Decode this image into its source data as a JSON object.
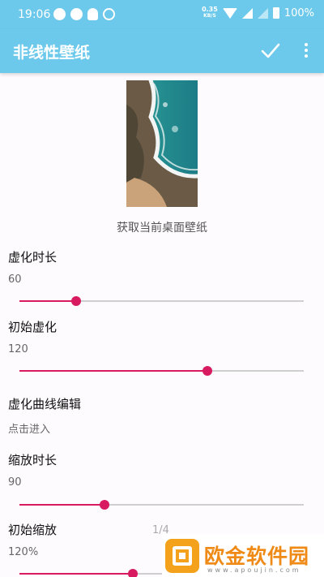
{
  "statusbar": {
    "time": "19:06",
    "net_speed": "0.35",
    "net_unit": "KB/S",
    "battery": "100%",
    "notification_icons": [
      "user-icon",
      "message-icon",
      "bell-icon",
      "chat-icon"
    ]
  },
  "appbar": {
    "title": "非线性壁纸",
    "actions": [
      "check-icon",
      "more-vert-icon"
    ]
  },
  "preview": {
    "caption": "获取当前桌面壁纸"
  },
  "settings": [
    {
      "title": "虚化时长",
      "value": "60",
      "slider": 0.2
    },
    {
      "title": "初始虚化",
      "value": "120",
      "slider": 0.66
    },
    {
      "title": "虚化曲线编辑",
      "value": "点击进入"
    },
    {
      "title": "缩放时长",
      "value": "90",
      "slider": 0.3
    },
    {
      "title": "初始缩放",
      "value": "120%",
      "slider": 0.4
    }
  ],
  "page_indicator": "1/4",
  "watermark": {
    "text": "欧金软件园",
    "url": "www.apoujin.com"
  },
  "colors": {
    "primary": "#6cc9eb",
    "accent": "#d81b60",
    "watermark": "#f08a16"
  }
}
